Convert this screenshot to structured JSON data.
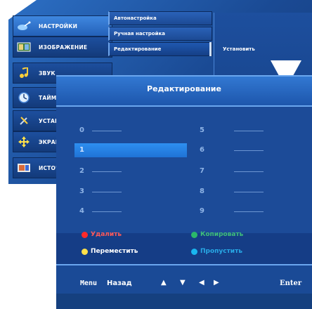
{
  "main_menu": {
    "items": [
      {
        "label": "НАСТРОЙКИ",
        "icon": "satellite-dish-icon",
        "active": true
      },
      {
        "label": "ИЗОБРАЖЕНИЕ",
        "icon": "picture-icon",
        "active": false
      },
      {
        "label": "ЗВУК",
        "icon": "music-note-icon",
        "active": false
      },
      {
        "label": "ТАЙМЕР",
        "icon": "clock-icon",
        "active": false
      },
      {
        "label": "УСТАНОВКИ",
        "icon": "tools-icon",
        "active": false
      },
      {
        "label": "ЭКРАН",
        "icon": "cross-arrows-icon",
        "active": false
      },
      {
        "label": "ИСТОЧНИК",
        "icon": "source-icon",
        "active": false
      }
    ],
    "submenu": [
      "Автонастройка",
      "Ручная настройка",
      "Редактирование"
    ],
    "right_label": "Установить"
  },
  "dialog": {
    "title": "Редактирование",
    "channels_left": [
      "0",
      "1",
      "2",
      "3",
      "4"
    ],
    "channels_right": [
      "5",
      "6",
      "7",
      "8",
      "9"
    ],
    "selected_channel": "1",
    "actions": {
      "delete": "Удалить",
      "copy": "Копировать",
      "move": "Переместить",
      "skip": "Пропустить"
    },
    "nav": {
      "menu": "Menu",
      "back": "Назад",
      "enter": "Enter"
    }
  },
  "colors": {
    "red": "#ff2a2a",
    "green": "#2bb86a",
    "yellow": "#ffe14a",
    "cyan": "#19b6f0"
  }
}
